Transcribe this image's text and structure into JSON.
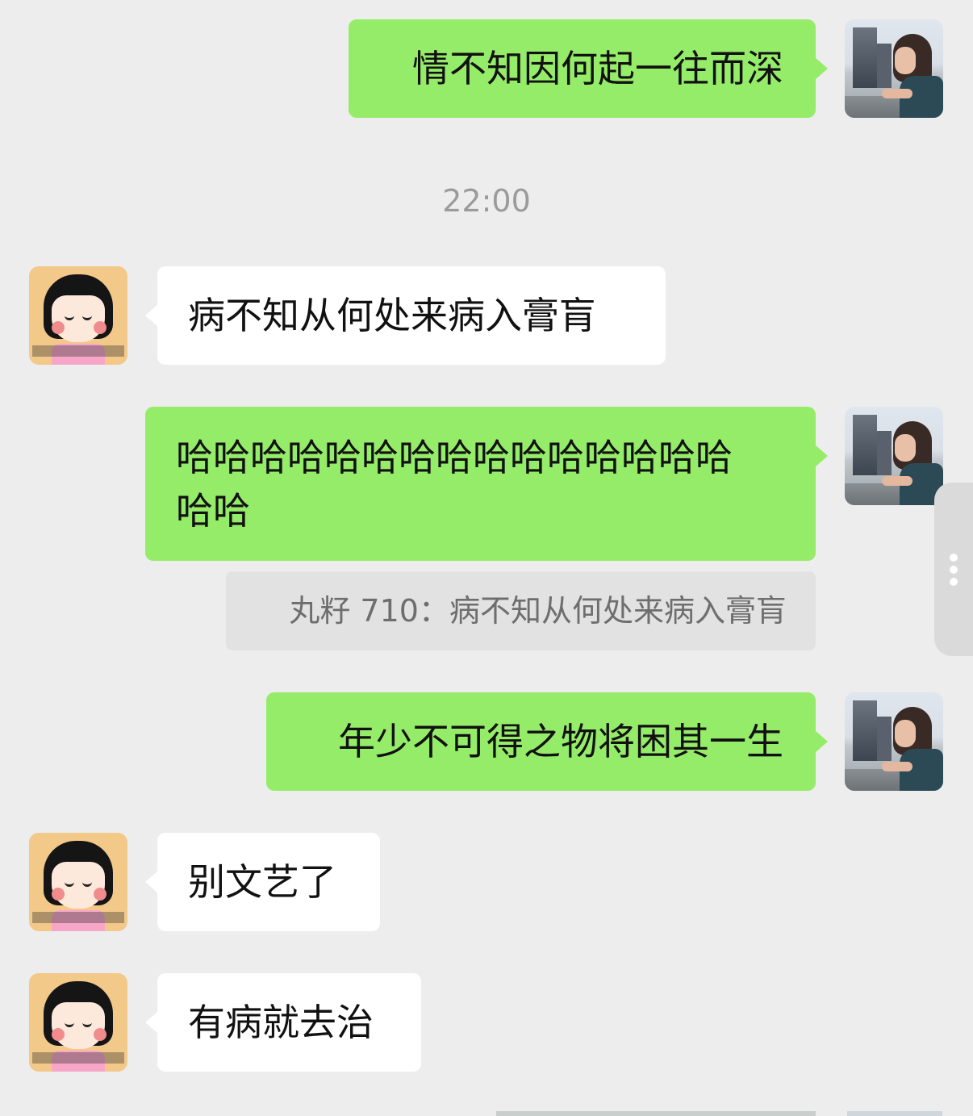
{
  "messages": [
    {
      "sender": "self",
      "text": "情不知因何起一往而深"
    },
    {
      "sender": "friend",
      "text": "病不知从何处来病入膏肓"
    },
    {
      "sender": "self",
      "text_line1": "哈哈哈哈哈哈哈哈哈哈哈哈哈哈哈",
      "text_line2": "哈哈"
    },
    {
      "sender": "self",
      "text": "年少不可得之物将困其一生"
    },
    {
      "sender": "friend",
      "text": "别文艺了"
    },
    {
      "sender": "friend",
      "text": "有病就去治"
    }
  ],
  "timestamp": "22:00",
  "quote": {
    "author": "丸籽 710",
    "separator": "：",
    "text": "病不知从何处来病入膏肓"
  },
  "colors": {
    "background": "#ededed",
    "self_bubble": "#95ec69",
    "friend_bubble": "#ffffff",
    "quote_bg": "#e2e2e2",
    "timestamp": "#9b9b9b"
  },
  "icons": {
    "self_avatar": "photo-avatar",
    "friend_avatar": "cartoon-avatar",
    "side_handle": "more-dots-icon"
  }
}
